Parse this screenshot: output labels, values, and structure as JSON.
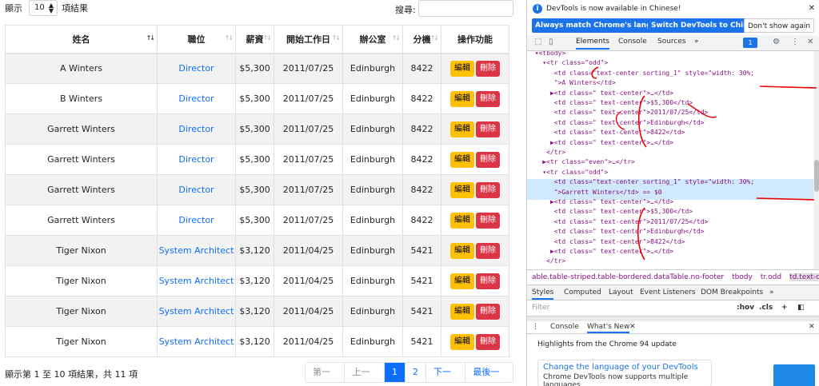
{
  "page": {
    "show_label": "顯示",
    "length_value": "10",
    "records_label": "項結果",
    "search_label": "搜尋:",
    "search_value": "",
    "columns": [
      "姓名",
      "職位",
      "薪資",
      "開始工作日",
      "辦公室",
      "分機",
      "操作功能"
    ],
    "rows": [
      {
        "name": "A Winters",
        "position": "Director",
        "salary": "$5,300",
        "start": "2011/07/25",
        "office": "Edinburgh",
        "ext": "8422"
      },
      {
        "name": "B Winters",
        "position": "Director",
        "salary": "$5,300",
        "start": "2011/07/25",
        "office": "Edinburgh",
        "ext": "8422"
      },
      {
        "name": "Garrett Winters",
        "position": "Director",
        "salary": "$5,300",
        "start": "2011/07/25",
        "office": "Edinburgh",
        "ext": "8422"
      },
      {
        "name": "Garrett Winters",
        "position": "Director",
        "salary": "$5,300",
        "start": "2011/07/25",
        "office": "Edinburgh",
        "ext": "8422"
      },
      {
        "name": "Garrett Winters",
        "position": "Director",
        "salary": "$5,300",
        "start": "2011/07/25",
        "office": "Edinburgh",
        "ext": "8422"
      },
      {
        "name": "Garrett Winters",
        "position": "Director",
        "salary": "$5,300",
        "start": "2011/07/25",
        "office": "Edinburgh",
        "ext": "8422"
      },
      {
        "name": "Tiger Nixon",
        "position": "System Architect",
        "salary": "$3,120",
        "start": "2011/04/25",
        "office": "Edinburgh",
        "ext": "5421"
      },
      {
        "name": "Tiger Nixon",
        "position": "System Architect",
        "salary": "$3,120",
        "start": "2011/04/25",
        "office": "Edinburgh",
        "ext": "5421"
      },
      {
        "name": "Tiger Nixon",
        "position": "System Architect",
        "salary": "$3,120",
        "start": "2011/04/25",
        "office": "Edinburgh",
        "ext": "5421"
      },
      {
        "name": "Tiger Nixon",
        "position": "System Architect",
        "salary": "$3,120",
        "start": "2011/04/25",
        "office": "Edinburgh",
        "ext": "5421"
      }
    ],
    "edit_label": "編輯",
    "delete_label": "刪除",
    "info": "顯示第 1 至 10 項結果，共 11 項",
    "pager": [
      "第一頁",
      "上一頁",
      "1",
      "2",
      "下一頁",
      "最後一頁"
    ],
    "active_page": "1"
  },
  "devtools": {
    "notice": "DevTools is now available in Chinese!",
    "btn_match": "Always match Chrome's language",
    "btn_switch": "Switch DevTools to Chinese",
    "btn_dont": "Don't show again",
    "tabs": [
      "Elements",
      "Console",
      "Sources",
      "»"
    ],
    "badge": "1",
    "dom_lines": [
      "  ▾<tbody>",
      "    ▾<tr class=\"odd\">",
      "       <td class=\"text-center sorting_1\" style=\"width: 30%;",
      "       \">A Winters</td>",
      "      ▶<td class=\" text-center\">…</td>",
      "       <td class=\" text-center\">$5,300</td>",
      "       <td class=\" text-center\">2011/07/25</td>",
      "       <td class=\" text-center\">Edinburgh</td>",
      "       <td class=\" text-center\">8422</td>",
      "      ▶<td class=\" text-center\">…</td>",
      "     </tr>",
      "    ▶<tr class=\"even\">…</tr>",
      "    ▾<tr class=\"odd\">",
      "       <td class=\"text-center sorting_1\" style=\"width: 30%;",
      "       \">Garrett Winters</td> == $0",
      "      ▶<td class=\" text-center\">…</td>",
      "       <td class=\" text-center\">$5,300</td>",
      "       <td class=\" text-center\">2011/07/25</td>",
      "       <td class=\" text-center\">Edinburgh</td>",
      "       <td class=\" text-center\">8422</td>",
      "      ▶<td class=\" text-center\">…</td>",
      "     </tr>"
    ],
    "breadcrumb": [
      "able.table-striped.table-bordered.dataTable.no-footer",
      "tbody",
      "tr.odd",
      "td.text-c"
    ],
    "subtabs": [
      "Styles",
      "Computed",
      "Layout",
      "Event Listeners",
      "DOM Breakpoints",
      "»"
    ],
    "filter_placeholder": "Filter",
    "filter_hov": ":hov",
    "filter_cls": ".cls",
    "drawer_tabs": [
      "Console",
      "What's New"
    ],
    "highlights": "Highlights from the Chrome 94 update",
    "card_title": "Change the language of your DevTools",
    "card_desc": "Chrome DevTools now supports multiple languages,"
  }
}
